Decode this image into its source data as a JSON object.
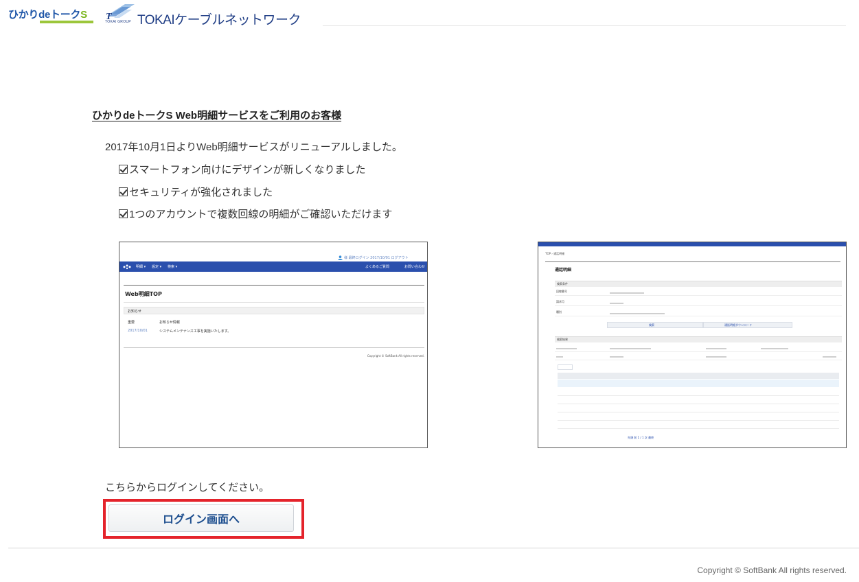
{
  "header": {
    "hikari_logo_main": "ひかりdeトーク",
    "hikari_logo_suffix": "S",
    "tokai_group_text": "TOKAI GROUP",
    "tokai_logo_mark": "T",
    "company_name": "TOKAIケーブルネットワーク"
  },
  "notice": {
    "title": "ひかりdeトークS Web明細サービスをご利用のお客様",
    "renewal_text": "2017年10月1日よりWeb明細サービスがリニューアルしました。",
    "features": [
      "スマートフォン向けにデザインが新しくなりました",
      "セキュリティが強化されました",
      "1つのアカウントで複数回線の明細がご確認いただけます"
    ]
  },
  "screenshot_top": {
    "header_status": "様 最終ログイン 2017/10/01 ログアウト",
    "nav_items": [
      "明細 ▾",
      "設定 ▾",
      "検索 ▾"
    ],
    "nav_right": [
      "よくあるご質問",
      "お問い合わせ"
    ],
    "page_title": "Web明細TOP",
    "section": "お知らせ",
    "rows": [
      {
        "label": "重要",
        "text": "お知らせ情報"
      },
      {
        "label": "2017/10/01",
        "text": "システムメンテナンス工事を実施いたします。"
      }
    ],
    "copyright": "Copyright © SoftBank All rights reserved."
  },
  "screenshot_detail": {
    "breadcrumb": "TOP › 通話明細",
    "page_title": "通話明細",
    "section_search": "検索条件",
    "field_labels": [
      "回線番号",
      "請求月",
      "種別"
    ],
    "search_button": "検索",
    "download_button": "通話明細ダウンロード",
    "section_result": "検索結果",
    "pager": "先頭 前 1 / 1 次 最終"
  },
  "login": {
    "prompt": "こちらからログインしてください。",
    "button_label": "ログイン画面へ"
  },
  "footer": {
    "copyright": "Copyright © SoftBank All rights reserved."
  }
}
